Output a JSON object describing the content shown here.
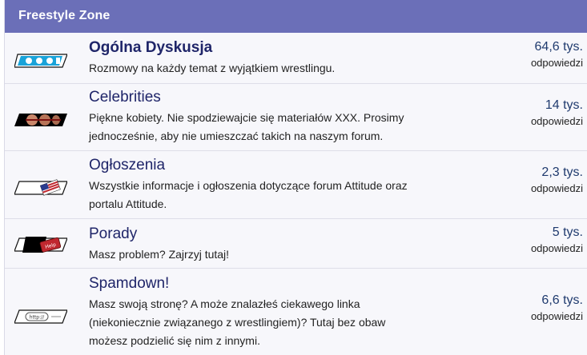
{
  "section": {
    "title": "Freestyle Zone"
  },
  "forums": [
    {
      "icon": "ring-logo-icon",
      "title": "Ogólna Dyskusja",
      "bold": true,
      "description": [
        "Rozmowy na każdy temat z wyjątkiem wrestlingu."
      ],
      "count": "64,6 tys.",
      "unit": "odpowiedzi"
    },
    {
      "icon": "celebrity-banner-icon",
      "title": "Celebrities",
      "bold": false,
      "description": [
        "Piękne kobiety. Nie spodziewajcie się materiałów XXX. Prosimy",
        "jednocześnie, aby nie umieszczać takich na naszym forum."
      ],
      "count": "14 tys.",
      "unit": "odpowiedzi"
    },
    {
      "icon": "announcement-flag-icon",
      "title": "Ogłoszenia",
      "bold": false,
      "description": [
        "Wszystkie informacje i ogłoszenia dotyczące forum Attitude oraz",
        "portalu Attitude."
      ],
      "count": "2,3 tys.",
      "unit": "odpowiedzi"
    },
    {
      "icon": "help-key-icon",
      "title": "Porady",
      "bold": false,
      "description": [
        "Masz problem? Zajrzyj tutaj!"
      ],
      "count": "5 tys.",
      "unit": "odpowiedzi"
    },
    {
      "icon": "http-link-icon",
      "title": "Spamdown!",
      "bold": false,
      "description": [
        "Masz swoją stronę? A może znalazłeś ciekawego linka",
        "(niekoniecznie związanego z wrestlingiem)? Tutaj bez obaw",
        "możesz podzielić się nim z innymi."
      ],
      "count": "6,6 tys.",
      "unit": "odpowiedzi"
    }
  ],
  "icon_labels": {
    "help": "Help",
    "http": "http://"
  },
  "colors": {
    "header": "#6b6fb8",
    "title": "#1f2569",
    "accent_red": "#c0282f",
    "ring_blue": "#1aa3d9"
  }
}
